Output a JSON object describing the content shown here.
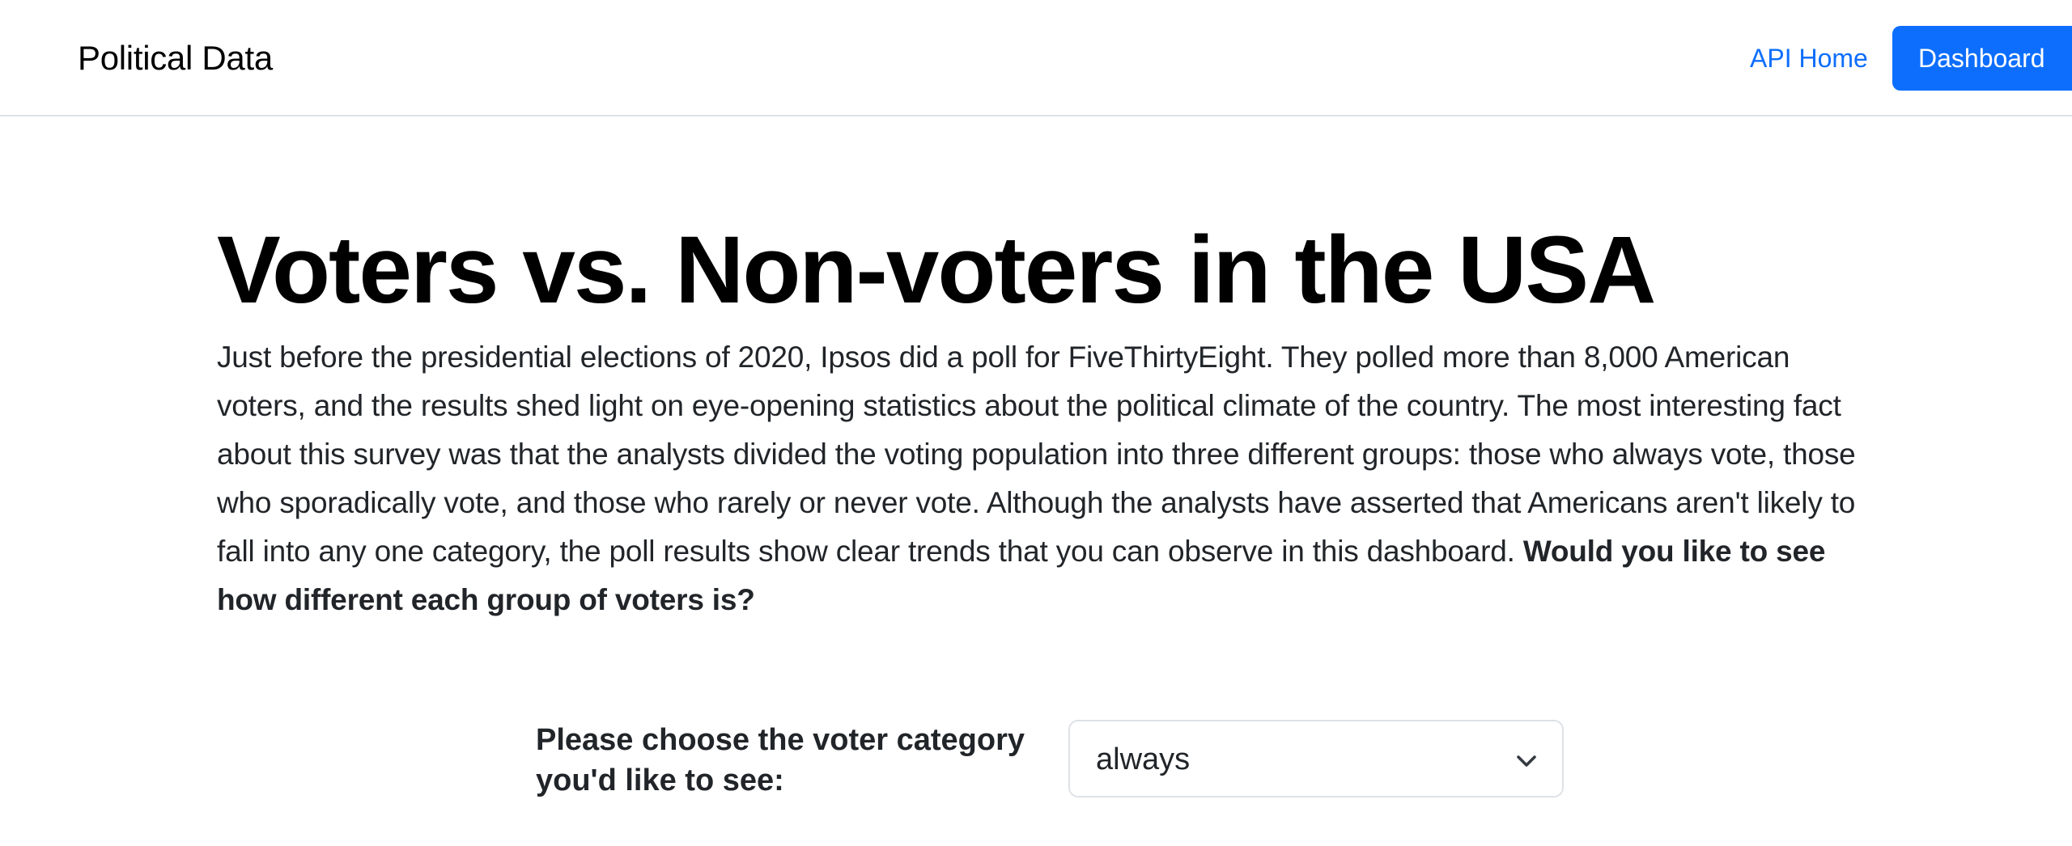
{
  "navbar": {
    "brand": "Political Data",
    "links": [
      {
        "label": "API Home"
      }
    ],
    "button_label": "Dashboard"
  },
  "main": {
    "title": "Voters vs. Non-voters in the USA",
    "intro_text": "Just before the presidential elections of 2020, Ipsos did a poll for FiveThirtyEight. They polled more than 8,000 American voters, and the results shed light on eye-opening statistics about the political climate of the country. The most interesting fact about this survey was that the analysts divided the voting population into three different groups: those who always vote, those who sporadically vote, and those who rarely or never vote. Although the analysts have asserted that Americans aren't likely to fall into any one category, the poll results show clear trends that you can observe in this dashboard. ",
    "intro_bold": "Would you like to see how different each group of voters is?"
  },
  "selector": {
    "label": "Please choose the voter category you'd like to see:",
    "selected_value": "always",
    "icon": "chevron-down-icon"
  },
  "colors": {
    "accent": "#0d6efd",
    "text": "#212529",
    "border": "#dee2e6"
  }
}
